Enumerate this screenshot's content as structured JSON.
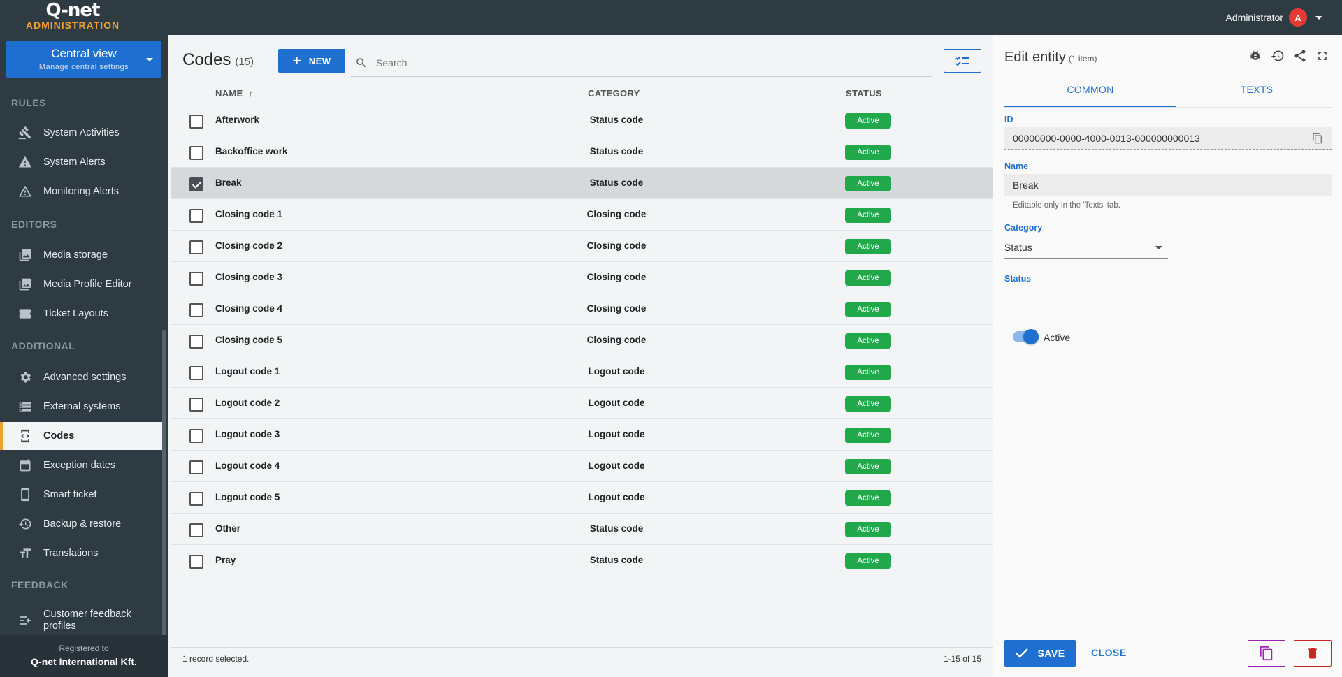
{
  "app": {
    "logo_main": "Q-net",
    "logo_sub": "ADMINISTRATION",
    "user_name": "Administrator",
    "user_initial": "A"
  },
  "view_selector": {
    "title": "Central view",
    "subtitle": "Manage central settings"
  },
  "sidebar": {
    "sections": {
      "rules": "RULES",
      "editors": "EDITORS",
      "additional": "ADDITIONAL",
      "feedback": "FEEDBACK"
    },
    "items": [
      {
        "label": "System Activities",
        "icon": "gavel-icon"
      },
      {
        "label": "System Alerts",
        "icon": "warning-icon"
      },
      {
        "label": "Monitoring Alerts",
        "icon": "warning-outline-icon"
      },
      {
        "label": "Media storage",
        "icon": "image-stack-icon"
      },
      {
        "label": "Media Profile Editor",
        "icon": "image-stack-icon"
      },
      {
        "label": "Ticket Layouts",
        "icon": "ticket-icon"
      },
      {
        "label": "Advanced settings",
        "icon": "gears-icon"
      },
      {
        "label": "External systems",
        "icon": "server-icon"
      },
      {
        "label": "Codes",
        "icon": "code-icon",
        "active": true
      },
      {
        "label": "Exception dates",
        "icon": "calendar-icon"
      },
      {
        "label": "Smart ticket",
        "icon": "phone-icon"
      },
      {
        "label": "Backup & restore",
        "icon": "backup-icon"
      },
      {
        "label": "Translations",
        "icon": "text-size-icon"
      },
      {
        "label": "Customer feedback profiles",
        "icon": "feedback-list-icon"
      }
    ],
    "registered_label": "Registered to",
    "registered_name": "Q-net International Kft."
  },
  "list": {
    "title": "Codes",
    "count": "(15)",
    "new_label": "NEW",
    "search_placeholder": "Search",
    "columns": {
      "name": "NAME",
      "category": "CATEGORY",
      "status": "STATUS"
    },
    "rows": [
      {
        "name": "Afterwork",
        "category": "Status code",
        "status": "Active",
        "selected": false
      },
      {
        "name": "Backoffice work",
        "category": "Status code",
        "status": "Active",
        "selected": false
      },
      {
        "name": "Break",
        "category": "Status code",
        "status": "Active",
        "selected": true
      },
      {
        "name": "Closing code 1",
        "category": "Closing code",
        "status": "Active",
        "selected": false
      },
      {
        "name": "Closing code 2",
        "category": "Closing code",
        "status": "Active",
        "selected": false
      },
      {
        "name": "Closing code 3",
        "category": "Closing code",
        "status": "Active",
        "selected": false
      },
      {
        "name": "Closing code 4",
        "category": "Closing code",
        "status": "Active",
        "selected": false
      },
      {
        "name": "Closing code 5",
        "category": "Closing code",
        "status": "Active",
        "selected": false
      },
      {
        "name": "Logout code 1",
        "category": "Logout code",
        "status": "Active",
        "selected": false
      },
      {
        "name": "Logout code 2",
        "category": "Logout code",
        "status": "Active",
        "selected": false
      },
      {
        "name": "Logout code 3",
        "category": "Logout code",
        "status": "Active",
        "selected": false
      },
      {
        "name": "Logout code 4",
        "category": "Logout code",
        "status": "Active",
        "selected": false
      },
      {
        "name": "Logout code 5",
        "category": "Logout code",
        "status": "Active",
        "selected": false
      },
      {
        "name": "Other",
        "category": "Status code",
        "status": "Active",
        "selected": false
      },
      {
        "name": "Pray",
        "category": "Status code",
        "status": "Active",
        "selected": false
      }
    ],
    "footer_selected": "1 record selected.",
    "footer_range": "1-15 of 15"
  },
  "edit": {
    "title": "Edit entity",
    "count": "(1 item)",
    "tabs": [
      "COMMON",
      "TEXTS"
    ],
    "id_label": "ID",
    "id_value": "00000000-0000-4000-0013-000000000013",
    "name_label": "Name",
    "name_value": "Break",
    "name_hint": "Editable only in the 'Texts' tab.",
    "category_label": "Category",
    "category_value": "Status",
    "status_label": "Status",
    "status_value": "Active",
    "status_on": true,
    "save_label": "SAVE",
    "close_label": "CLOSE"
  },
  "colors": {
    "accent": "#1e6fd0",
    "sidebar_bg": "#2e3b43",
    "brand_orange": "#f0a22e",
    "status_active": "#21a84a",
    "delete": "#c62828"
  }
}
